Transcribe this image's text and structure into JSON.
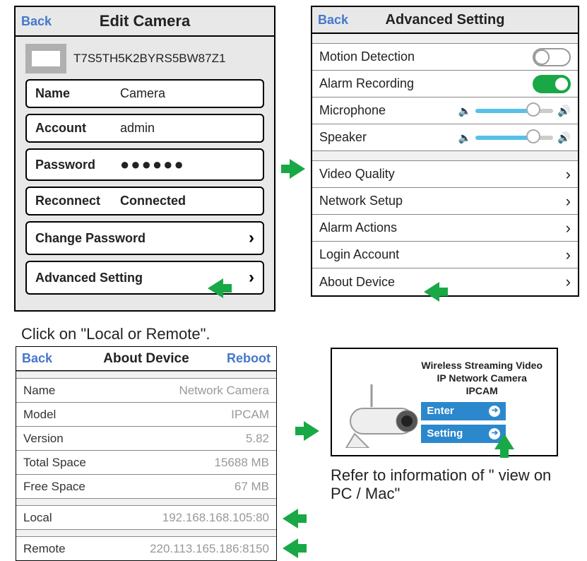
{
  "panel1": {
    "back": "Back",
    "title": "Edit Camera",
    "serial": "T7S5TH5K2BYRS5BW87Z1",
    "name_label": "Name",
    "name_value": "Camera",
    "account_label": "Account",
    "account_value": "admin",
    "password_label": "Password",
    "password_mask": "●●●●●●",
    "reconnect_label": "Reconnect",
    "reconnect_value": "Connected",
    "change_pw": "Change Password",
    "advanced": "Advanced Setting"
  },
  "panel2": {
    "back": "Back",
    "title": "Advanced Setting",
    "motion": "Motion Detection",
    "alarm_rec": "Alarm Recording",
    "mic": "Microphone",
    "speaker": "Speaker",
    "video_q": "Video Quality",
    "network": "Network Setup",
    "alarm_act": "Alarm Actions",
    "login": "Login Account",
    "about": "About Device",
    "motion_on": false,
    "alarm_rec_on": true
  },
  "instruction1": "Click on \"Local or Remote\".",
  "panel3": {
    "back": "Back",
    "title": "About Device",
    "reboot": "Reboot",
    "rows": {
      "name_l": "Name",
      "name_v": "Network Camera",
      "model_l": "Model",
      "model_v": "IPCAM",
      "version_l": "Version",
      "version_v": "5.82",
      "total_l": "Total Space",
      "total_v": "15688 MB",
      "free_l": "Free Space",
      "free_v": "67 MB",
      "local_l": "Local",
      "local_v": "192.168.168.105:80",
      "remote_l": "Remote",
      "remote_v": "220.113.165.186:8150"
    }
  },
  "panel4": {
    "line1": "Wireless Streaming Video",
    "line2": "IP Network Camera",
    "model": "IPCAM",
    "enter": "Enter",
    "setting": "Setting"
  },
  "instruction2": "Refer to information of \" view on PC / Mac\""
}
